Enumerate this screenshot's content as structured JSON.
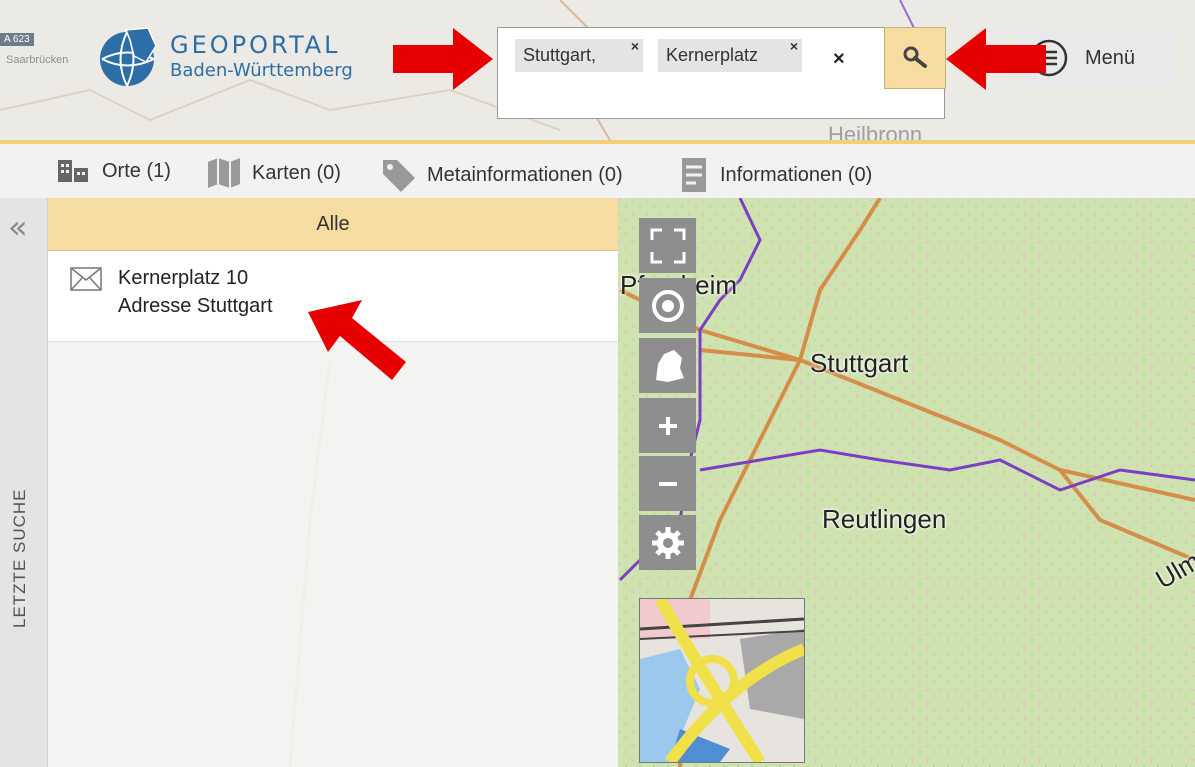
{
  "logo": {
    "title": "GEOPORTAL",
    "subtitle": "Baden-Württemberg"
  },
  "search": {
    "chips": [
      {
        "label": "Stuttgart,"
      },
      {
        "label": "Kernerplatz"
      }
    ],
    "chip_remove": "×",
    "clear": "×",
    "button_icon": "search-icon"
  },
  "menu": {
    "label": "Menü",
    "icon": "menu-list-icon"
  },
  "tabs": [
    {
      "label": "Orte (1)",
      "icon": "buildings-icon"
    },
    {
      "label": "Karten (0)",
      "icon": "map-icon"
    },
    {
      "label": "Metainformationen (0)",
      "icon": "tag-icon"
    },
    {
      "label": "Informationen (0)",
      "icon": "document-icon"
    }
  ],
  "sidebar": {
    "label": "LETZTE SUCHE",
    "collapse": "«"
  },
  "results": {
    "filter_label": "Alle",
    "items": [
      {
        "title": "Kernerplatz 10",
        "subtitle": "Adresse Stuttgart",
        "icon": "mail-icon"
      }
    ]
  },
  "map": {
    "cities": [
      "Pforzheim",
      "Stuttgart",
      "Reutlingen",
      "Ulm"
    ],
    "header_places": [
      "Saarbrücken",
      "Heilbronn"
    ],
    "road_badge": "A 623",
    "controls": [
      "fullscreen-icon",
      "locate-icon",
      "state-shape-icon",
      "zoom-in-icon",
      "zoom-out-icon",
      "settings-icon"
    ]
  },
  "colors": {
    "accent": "#f7dca2",
    "brand": "#2e6ea6",
    "arrow": "#e60000",
    "control": "#8e8e8e"
  }
}
